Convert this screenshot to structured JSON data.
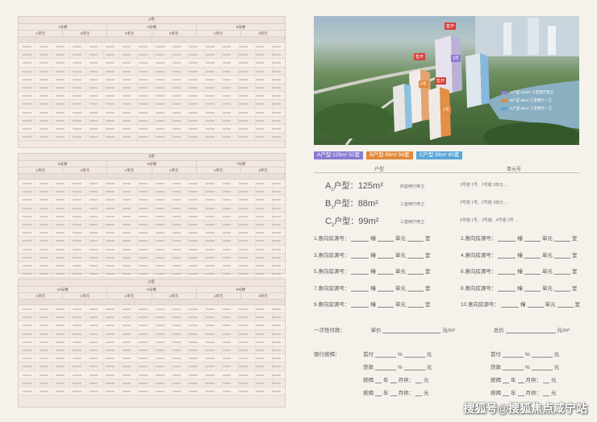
{
  "tables": [
    {
      "title": "2号",
      "buildings": [
        "1号楼",
        "3号楼",
        "5号楼"
      ],
      "units": [
        "1单元",
        "2单元",
        "1单元",
        "2单元",
        "1单元",
        "2单元"
      ],
      "rows": 12,
      "cols": 16
    },
    {
      "title": "3号",
      "buildings": [
        "8号楼",
        "9号楼",
        "7号楼"
      ],
      "units": [
        "1单元",
        "2单元",
        "1单元",
        "2单元",
        "1单元",
        "2单元"
      ],
      "rows": 12,
      "cols": 16
    },
    {
      "title": "5号",
      "buildings": [
        "16号楼",
        "6号楼",
        "9号楼"
      ],
      "units": [
        "1单元",
        "2单元",
        "1单元",
        "2单元",
        "1单元",
        "2单元"
      ],
      "rows": 11,
      "cols": 16
    }
  ],
  "render": {
    "building_tags": [
      "售开",
      "3号",
      "售开",
      "5号",
      "售开",
      "2号"
    ],
    "legend": [
      "A户型 125m² 三室两厅两卫",
      "B户型 88m² 三室两厅一卫",
      "C户型 99m² 三室两厅一卫"
    ]
  },
  "type_tags": [
    {
      "label": "A户型 125m² 52套",
      "color": "#8a7bd0"
    },
    {
      "label": "B户型 88m² 56套",
      "color": "#e28a3b"
    },
    {
      "label": "C户型 99m² 80套",
      "color": "#5aa6d8"
    }
  ],
  "section_heads": {
    "left": "户型",
    "right": "单元号"
  },
  "unit_types": [
    {
      "code": "A",
      "sub": "1",
      "area": "125m²",
      "desc": "四室两厅两卫"
    },
    {
      "code": "B",
      "sub": "1",
      "area": "88m²",
      "desc": "三室两厅两卫"
    },
    {
      "code": "C",
      "sub": "1",
      "area": "99m²",
      "desc": "三室两厅两卫"
    }
  ],
  "unit_notes": [
    "3号楼 1号、2号楼 3单元 …",
    "2号楼 1号、2号楼 3单元 …",
    "5号楼 1号、3号楼、4号楼 3号 …"
  ],
  "form": {
    "intent_rows": [
      [
        "1.意向房源号：",
        "幢",
        "单元",
        "室",
        "2.意向房源号：",
        "幢",
        "单元",
        "室"
      ],
      [
        "3.意向房源号：",
        "幢",
        "单元",
        "室",
        "4.意向房源号：",
        "幢",
        "单元",
        "室"
      ],
      [
        "5.意向房源号：",
        "幢",
        "单元",
        "室",
        "6.意向房源号：",
        "幢",
        "单元",
        "室"
      ],
      [
        "7.意向房源号：",
        "幢",
        "单元",
        "室",
        "8.意向房源号：",
        "幢",
        "单元",
        "室"
      ],
      [
        "9.意向房源号：",
        "幢",
        "单元",
        "室",
        "10.意向房源号：",
        "幢",
        "单元",
        "室"
      ]
    ],
    "lump_sum": {
      "label": "一次性付款：",
      "unit_price": "单价",
      "unit": "元/m²",
      "total": "总价",
      "total_unit": "元/m²"
    },
    "mortgage_label": "银行按揭：",
    "mortgage_rows": [
      [
        "首付",
        "%",
        "元",
        "首付",
        "%",
        "元"
      ],
      [
        "贷款",
        "%",
        "元",
        "贷款",
        "%",
        "元"
      ],
      [
        "按揭",
        "年",
        "月供：",
        "元",
        "按揭",
        "年",
        "月供：",
        "元"
      ],
      [
        "按揭",
        "年",
        "月供：",
        "元",
        "按揭",
        "年",
        "月供：",
        "元"
      ]
    ]
  },
  "watermark": "搜狐号@搜狐焦点咸宁站"
}
